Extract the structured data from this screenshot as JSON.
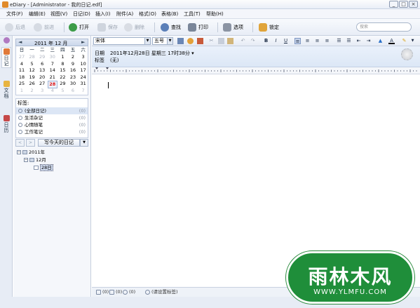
{
  "window": {
    "title": "eDiary - [Administrator - 我的日记.edf]"
  },
  "menu": [
    "文件(F)",
    "编辑(E)",
    "视图(V)",
    "日记(D)",
    "插入(I)",
    "附件(A)",
    "格式(O)",
    "表格(B)",
    "工具(T)",
    "帮助(H)"
  ],
  "toolbar": {
    "back": "后退",
    "forward": "前进",
    "open": "打开",
    "save": "保存",
    "delete": "删除",
    "find": "查找",
    "print": "打印",
    "options": "选项",
    "lock": "锁定",
    "search_placeholder": "搜索"
  },
  "vtabs": [
    "日记",
    "文档",
    "日历"
  ],
  "calendar": {
    "title": "2011 年 12 月",
    "dow": [
      "日",
      "一",
      "二",
      "三",
      "四",
      "五",
      "六"
    ],
    "weeks": [
      [
        {
          "d": "27",
          "o": 1
        },
        {
          "d": "28",
          "o": 1
        },
        {
          "d": "29",
          "o": 1
        },
        {
          "d": "30",
          "o": 1
        },
        {
          "d": "1"
        },
        {
          "d": "2"
        },
        {
          "d": "3"
        }
      ],
      [
        {
          "d": "4"
        },
        {
          "d": "5"
        },
        {
          "d": "6"
        },
        {
          "d": "7"
        },
        {
          "d": "8"
        },
        {
          "d": "9"
        },
        {
          "d": "10"
        }
      ],
      [
        {
          "d": "11"
        },
        {
          "d": "12"
        },
        {
          "d": "13"
        },
        {
          "d": "14"
        },
        {
          "d": "15"
        },
        {
          "d": "16"
        },
        {
          "d": "17"
        }
      ],
      [
        {
          "d": "18"
        },
        {
          "d": "19"
        },
        {
          "d": "20"
        },
        {
          "d": "21"
        },
        {
          "d": "22"
        },
        {
          "d": "23"
        },
        {
          "d": "24"
        }
      ],
      [
        {
          "d": "25"
        },
        {
          "d": "26"
        },
        {
          "d": "27"
        },
        {
          "d": "28",
          "t": 1
        },
        {
          "d": "29"
        },
        {
          "d": "30"
        },
        {
          "d": "31"
        }
      ],
      [
        {
          "d": "1",
          "o": 1
        },
        {
          "d": "2",
          "o": 1
        },
        {
          "d": "3",
          "o": 1
        },
        {
          "d": "4",
          "o": 1
        },
        {
          "d": "5",
          "o": 1
        },
        {
          "d": "6",
          "o": 1
        },
        {
          "d": "7",
          "o": 1
        }
      ]
    ]
  },
  "tags": {
    "title": "标签:",
    "items": [
      {
        "label": "(全部日记)",
        "count": "(0)"
      },
      {
        "label": "生活杂记",
        "count": "(0)"
      },
      {
        "label": "心情随笔",
        "count": "(0)"
      },
      {
        "label": "工作笔记",
        "count": "(0)"
      }
    ]
  },
  "nav": {
    "prev": "<",
    "next": ">",
    "write_today": "写今天的日记",
    "drop": "▼"
  },
  "tree": {
    "year": "2011年",
    "month": "12月",
    "day": "28日"
  },
  "format": {
    "font": "宋体",
    "size": "五号",
    "bold": "B",
    "italic": "I",
    "underline": "U"
  },
  "doc": {
    "date_label": "日期",
    "date_value": "2011年12月28日 星期三 17时38分 ▾",
    "tag_label": "标签",
    "tag_value": "(无)"
  },
  "status": {
    "attach1": "(0)",
    "attach2": "(0)",
    "comments": "(0)",
    "tag_hint": "(请设置标签)"
  },
  "watermark": {
    "title": "雨林木风",
    "url": "WWW.YLMFU.COM"
  },
  "colors": {
    "accent": "#1f8e3a",
    "panel": "#f5f7fb",
    "header": "#dce7f6"
  }
}
